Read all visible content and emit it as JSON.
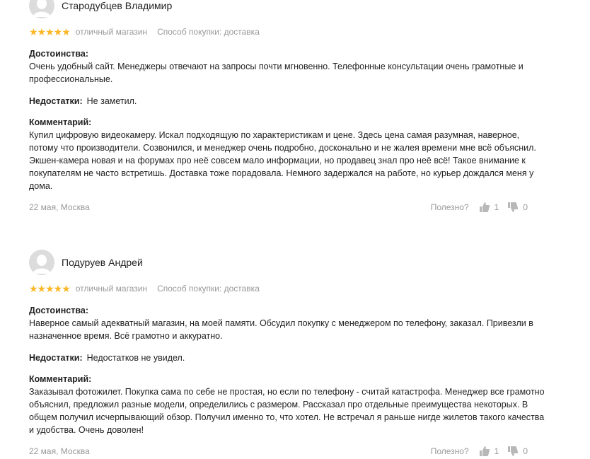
{
  "reviews": [
    {
      "author": "Стародубцев Владимир",
      "stars": "★★★★★",
      "grade": "отличный магазин",
      "purchase": "Способ покупки: доставка",
      "pros_title": "Достоинства:",
      "pros": "Очень удобный сайт. Менеджеры отвечают на запросы почти мгновенно. Телефонные консультации очень грамотные и профессиональные.",
      "cons_title": "Недостатки:",
      "cons": "Не заметил.",
      "comment_title": "Комментарий:",
      "comment": "Купил цифровую видеокамеру. Искал подходящую по характеристикам и цене. Здесь цена самая разумная, наверное, потому что производители. Созвонился, и менеджер очень подробно, досконально и не жалея времени мне всё объяснил. Экшен-камера новая и на форумах про неё совсем мало информации, но продавец знал про неё всё! Такое внимание к покупателям не часто встретишь. Доставка тоже порадовала. Немного задержался на работе, но курьер дождался меня у дома.",
      "date": "22 мая, Москва",
      "useful": "Полезно?",
      "likes": "1",
      "dislikes": "0"
    },
    {
      "author": "Подуруев Андрей",
      "stars": "★★★★★",
      "grade": "отличный магазин",
      "purchase": "Способ покупки: доставка",
      "pros_title": "Достоинства:",
      "pros": "Наверное самый адекватный магазин, на моей памяти. Обсудил покупку с менеджером по телефону, заказал. Привезли в назначенное время. Всё грамотно и аккуратно.",
      "cons_title": "Недостатки:",
      "cons": "Недостатков не увидел.",
      "comment_title": "Комментарий:",
      "comment": "Заказывал фотожилет. Покупка сама по себе не простая, но если по телефону - считай катастрофа. Менеджер все грамотно объяснил, предложил разные модели, определились с размером. Рассказал про отдельные преимущества некоторых. В общем получил исчерпывающий обзор. Получил именно то, что хотел. Не встречал я раньше нигде жилетов такого качества и удобства. Очень доволен!",
      "date": "22 мая, Москва",
      "useful": "Полезно?",
      "likes": "1",
      "dislikes": "0"
    }
  ],
  "colors": {
    "star": "#fdb726",
    "muted": "#999999",
    "text": "#222222"
  },
  "icons": {
    "avatar": "user-silhouette-icon",
    "like": "thumb-up-icon",
    "dislike": "thumb-down-icon"
  }
}
